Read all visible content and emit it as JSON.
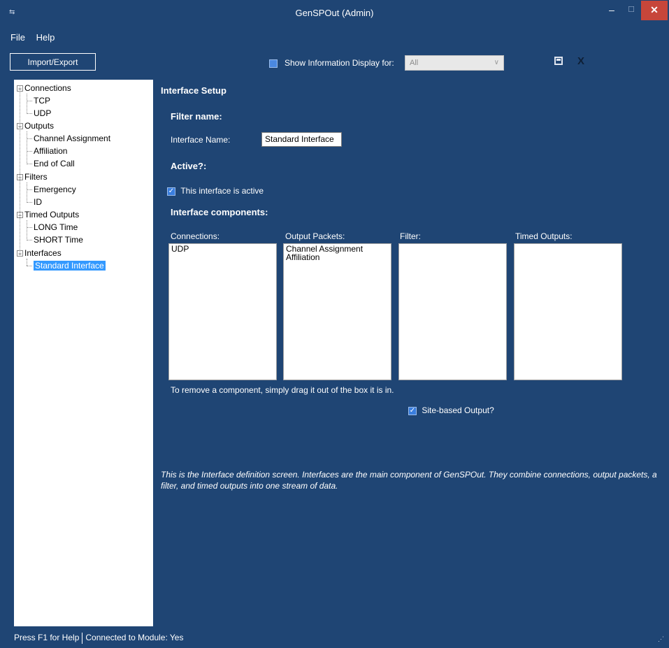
{
  "window": {
    "title": "GenSPOut (Admin)",
    "min_glyph": "–",
    "max_glyph": "☐",
    "close_glyph": "✕"
  },
  "menu": {
    "file": "File",
    "help": "Help"
  },
  "toolbar": {
    "import_export": "Import/Export",
    "show_info_label": "Show Information Display for:",
    "show_info_value": "All"
  },
  "tree": {
    "connections": "Connections",
    "tcp": "TCP",
    "udp": "UDP",
    "outputs": "Outputs",
    "channel_assignment": "Channel Assignment",
    "affiliation": "Affiliation",
    "end_of_call": "End of Call",
    "filters": "Filters",
    "emergency": "Emergency",
    "id": "ID",
    "timed_outputs": "Timed Outputs",
    "long_time": "LONG Time",
    "short_time": "SHORT Time",
    "interfaces": "Interfaces",
    "standard_interface": "Standard Interface"
  },
  "main": {
    "section_title": "Interface Setup",
    "filter_name_heading": "Filter name:",
    "interface_name_label": "Interface Name:",
    "interface_name_value": "Standard Interface",
    "active_heading": "Active?:",
    "active_checkbox_label": "This interface is active",
    "components_heading": "Interface components:",
    "col_connections": "Connections:",
    "col_output_packets": "Output Packets:",
    "col_filter": "Filter:",
    "col_timed_outputs": "Timed Outputs:",
    "connections_items": [
      "UDP"
    ],
    "output_packets_items": [
      "Channel Assignment",
      "Affiliation"
    ],
    "remove_hint": "To remove a component, simply drag it out of the box it is in.",
    "site_based_label": "Site-based Output?",
    "info_text": "This is the Interface definition screen.  Interfaces are the main component of GenSPOut.  They combine connections, output packets, a filter, and timed outputs into one stream of data."
  },
  "status": {
    "help": "Press F1 for Help",
    "connection": "Connected to Module: Yes"
  },
  "icons": {
    "save": "save-icon",
    "close": "close-x-icon",
    "check": "checkmark-icon"
  },
  "colors": {
    "background": "#1f4574",
    "close_button": "#c7463a",
    "selection": "#3399ff"
  }
}
